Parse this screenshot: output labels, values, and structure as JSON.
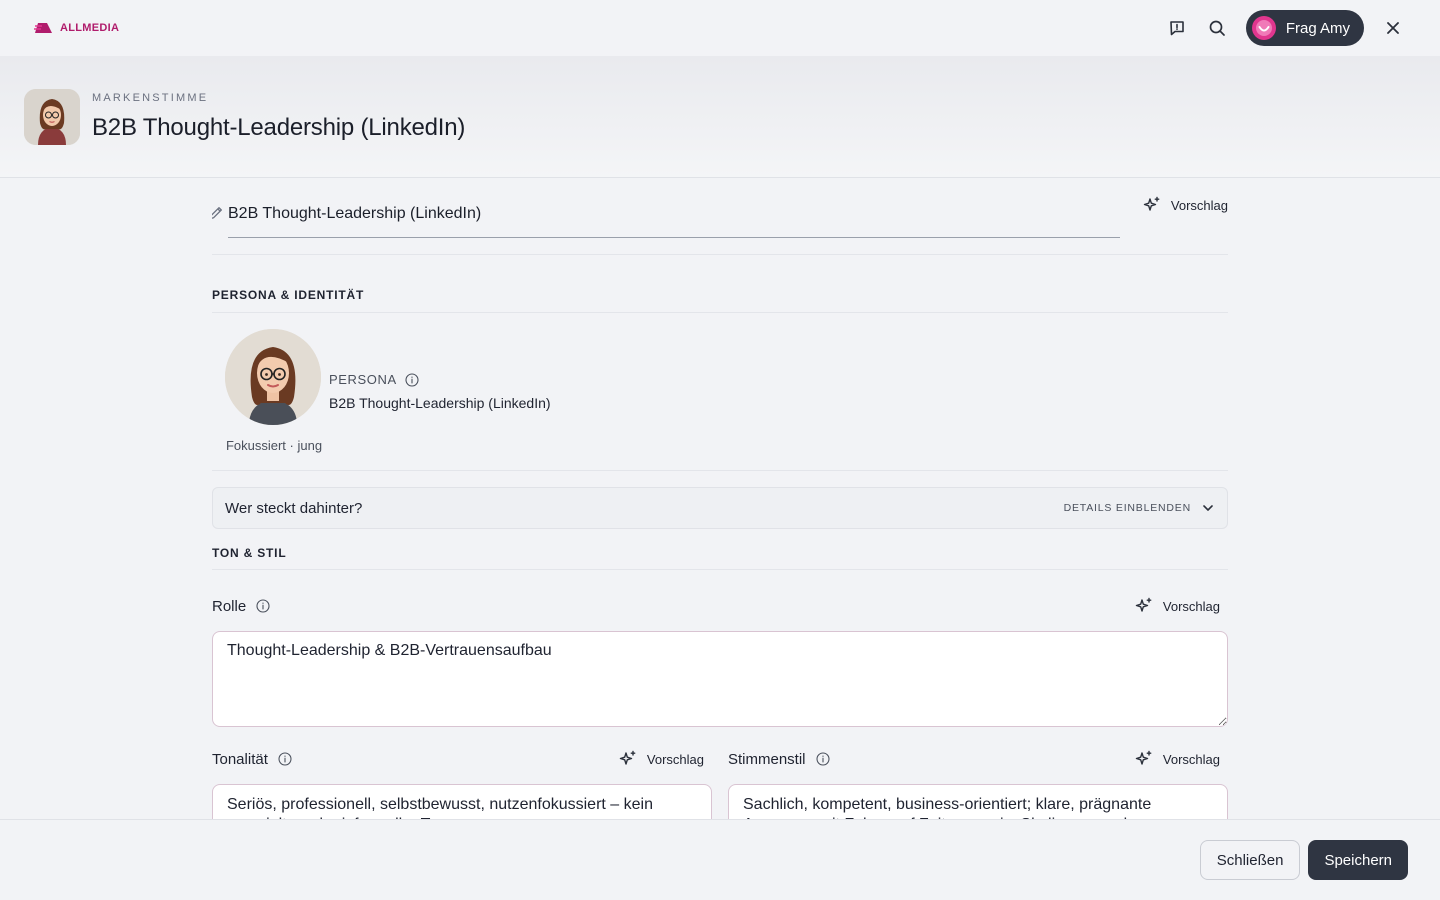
{
  "app": {
    "logo_text": "ALLMEDIA",
    "brand_color": "#b01c6c"
  },
  "topbar": {
    "ask_label": "Frag Amy"
  },
  "header": {
    "eyebrow": "MARKENSTIMME",
    "title": "B2B Thought-Leadership (LinkedIn)"
  },
  "name_field": {
    "value": "B2B Thought-Leadership (LinkedIn)",
    "suggest_label": "Vorschlag"
  },
  "persona_section": {
    "title": "PERSONA & IDENTITÄT",
    "sub": "Fokussiert · jung",
    "label": "PERSONA",
    "name": "B2B Thought-Leadership (LinkedIn)"
  },
  "accordion": {
    "title": "Wer steckt dahinter?",
    "toggle_label": "DETAILS EINBLENDEN"
  },
  "style_section": {
    "title": "TON & STIL",
    "rolle": {
      "label": "Rolle",
      "suggest_label": "Vorschlag",
      "value": "Thought-Leadership & B2B-Vertrauensaufbau"
    },
    "tonalitaet": {
      "label": "Tonalität",
      "suggest_label": "Vorschlag",
      "value": "Seriös, professionell, selbstbewusst, nutzenfokussiert – kein verspielter oder informeller Ton"
    },
    "stimmenstil": {
      "label": "Stimmenstil",
      "suggest_label": "Vorschlag",
      "value": "Sachlich, kompetent, business-orientiert; klare, prägnante Aussagen mit Fokus auf Zeitersparnis, Skalierung und"
    }
  },
  "footer": {
    "close_label": "Schließen",
    "save_label": "Speichern"
  }
}
